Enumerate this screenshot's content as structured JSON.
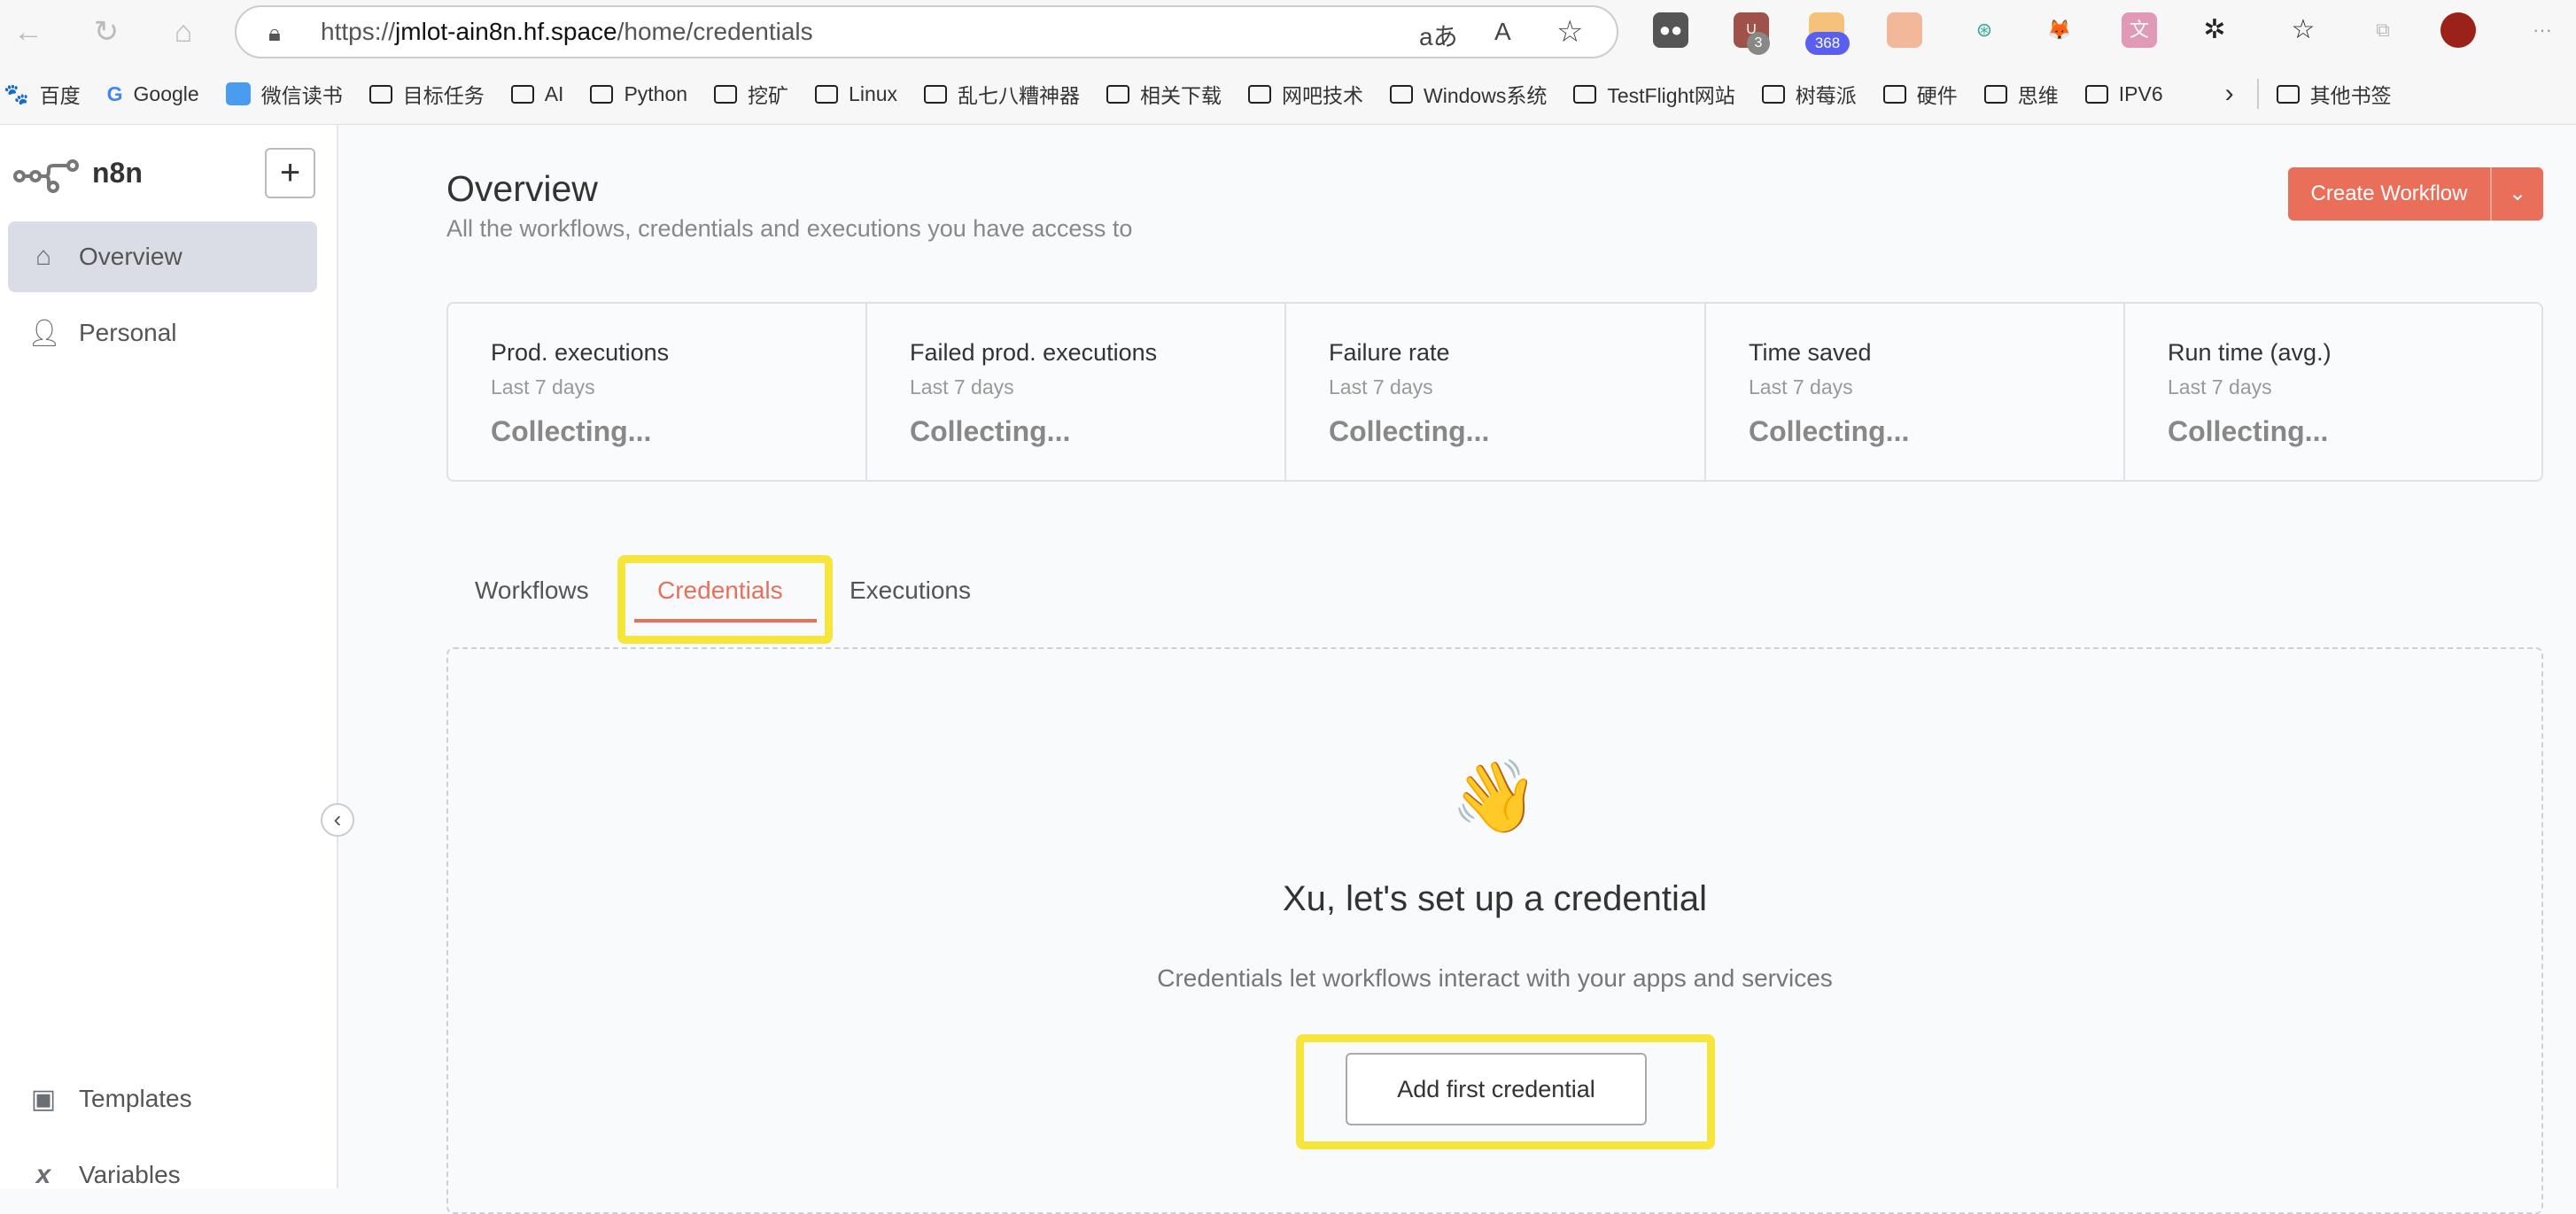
{
  "browser": {
    "url_prefix": "https://",
    "url_host": "jmlot-ain8n.hf.space",
    "url_path": "/home/credentials",
    "ext_badge_1": "3",
    "ext_badge_2": "368",
    "bookmarks": [
      "百度",
      "Google",
      "微信读书",
      "目标任务",
      "AI",
      "Python",
      "挖矿",
      "Linux",
      "乱七八糟神器",
      "相关下载",
      "网吧技术",
      "Windows系统",
      "TestFlight网站",
      "树莓派",
      "硬件",
      "思维",
      "IPV6"
    ],
    "other_bookmarks": "其他书签"
  },
  "sidebar": {
    "brand": "n8n",
    "items": [
      {
        "label": "Overview",
        "icon": "home-icon"
      },
      {
        "label": "Personal",
        "icon": "user-icon"
      }
    ],
    "bottom": [
      {
        "label": "Templates",
        "icon": "box-icon"
      },
      {
        "label": "Variables",
        "icon": "variable-icon"
      }
    ]
  },
  "header": {
    "title": "Overview",
    "subtitle": "All the workflows, credentials and executions you have access to",
    "create_button": "Create Workflow"
  },
  "stats": [
    {
      "title": "Prod. executions",
      "period": "Last 7 days",
      "value": "Collecting..."
    },
    {
      "title": "Failed prod. executions",
      "period": "Last 7 days",
      "value": "Collecting..."
    },
    {
      "title": "Failure rate",
      "period": "Last 7 days",
      "value": "Collecting..."
    },
    {
      "title": "Time saved",
      "period": "Last 7 days",
      "value": "Collecting..."
    },
    {
      "title": "Run time (avg.)",
      "period": "Last 7 days",
      "value": "Collecting..."
    }
  ],
  "tabs": [
    {
      "label": "Workflows"
    },
    {
      "label": "Credentials",
      "active": true
    },
    {
      "label": "Executions"
    }
  ],
  "empty_state": {
    "emoji": "👋",
    "heading": "Xu, let's set up a credential",
    "description": "Credentials let workflows interact with your apps and services",
    "button": "Add first credential"
  },
  "colors": {
    "accent": "#ea6f5a",
    "highlight": "#f7e53b"
  }
}
